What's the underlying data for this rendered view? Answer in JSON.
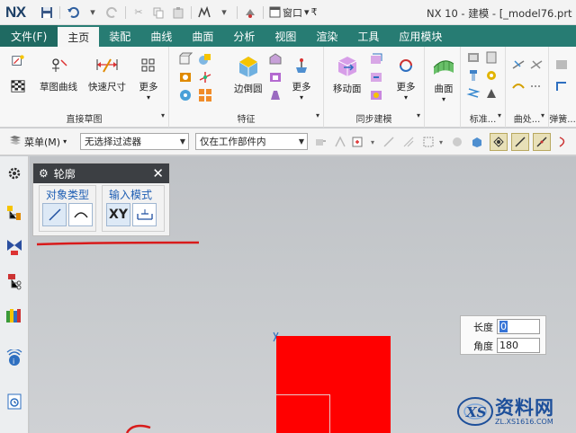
{
  "titlebar": {
    "logo": "NX",
    "window_menu": "窗口",
    "title": "NX 10 - 建模 - [_model76.prt（"
  },
  "tabs": [
    {
      "label": "文件(F)"
    },
    {
      "label": "主页"
    },
    {
      "label": "装配"
    },
    {
      "label": "曲线"
    },
    {
      "label": "曲面"
    },
    {
      "label": "分析"
    },
    {
      "label": "视图"
    },
    {
      "label": "渲染"
    },
    {
      "label": "工具"
    },
    {
      "label": "应用模块"
    }
  ],
  "ribbon": {
    "sketch_curve": "草图曲线",
    "quick_dimension": "快速尺寸",
    "more1": "更多",
    "group_direct_sketch": "直接草图",
    "edge_blend": "边倒圆",
    "more2": "更多",
    "group_feature": "特征",
    "move_face": "移动面",
    "more3": "更多",
    "group_sync": "同步建模",
    "surface": "曲面",
    "group_standard": "标准...",
    "group_surface_ops": "曲处...",
    "group_sheet": "弹簧..."
  },
  "filterbar": {
    "menu": "菜单(M)",
    "filter_value": "无选择过滤器",
    "scope_value": "仅在工作部件内"
  },
  "dialog": {
    "title": "轮廓",
    "object_type": "对象类型",
    "input_mode": "输入模式",
    "xy_label": "XY"
  },
  "inputbox": {
    "length_label": "长度",
    "length_value": "0",
    "angle_label": "角度",
    "angle_value": "180"
  },
  "watermark": {
    "text": "资料网",
    "url": "ZL.XS1616.COM"
  },
  "colors": {
    "tab_bar": "#277c73",
    "sketch_fill": "#ff0000",
    "annotation_red": "#d81b1b"
  }
}
